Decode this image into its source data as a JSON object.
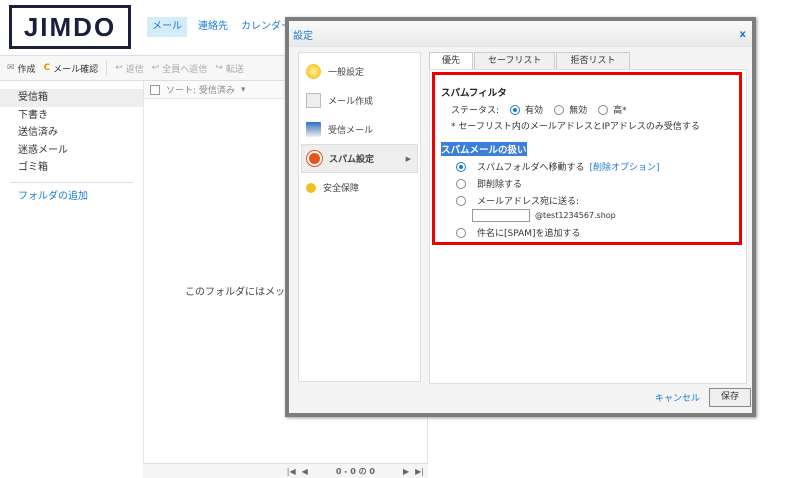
{
  "header": {
    "logo": "JIMDO",
    "nav": [
      "メール",
      "連絡先",
      "カレンダー"
    ]
  },
  "toolbar": {
    "compose": "作成",
    "check": "メール確認",
    "reply": "返信",
    "reply_all": "全員へ返信",
    "forward": "転送"
  },
  "sidebar": {
    "folders": [
      "受信箱",
      "下書き",
      "送信済み",
      "迷惑メール",
      "ゴミ箱"
    ],
    "add_folder": "フォルダの追加"
  },
  "list": {
    "sort": "ソート: 受信済み",
    "empty": "このフォルダにはメッセ",
    "pager": "0 - 0 の 0"
  },
  "dialog": {
    "title": "設定",
    "close": "x",
    "nav": [
      {
        "label": "一般設定",
        "icon": "gear-icon"
      },
      {
        "label": "メール作成",
        "icon": "compose-icon"
      },
      {
        "label": "受信メール",
        "icon": "inbox-icon"
      },
      {
        "label": "スパム設定",
        "icon": "no-entry-icon"
      },
      {
        "label": "安全保障",
        "icon": "key-icon"
      }
    ],
    "tabs": [
      "優先",
      "セーフリスト",
      "拒否リスト"
    ],
    "spam_filter": {
      "heading": "スパムフィルタ",
      "status_label": "ステータス:",
      "options": [
        "有効",
        "無効",
        "高*"
      ],
      "selected": "有効",
      "note": "* セーフリスト内のメールアドレスとIPアドレスのみ受信する"
    },
    "handling": {
      "heading": "スパムメールの扱い",
      "move": "スパムフォルダへ移動する",
      "delete_options": "[削除オプション]",
      "delete_now": "即削除する",
      "send_to": "メールアドレス宛に送る:",
      "address_value": "",
      "domain": "@test1234567.shop",
      "add_tag": "件名に[SPAM]を追加する",
      "selected": "move"
    },
    "cancel": "キャンセル",
    "save": "保存"
  },
  "colors": {
    "accent": "#1a7bd1",
    "highlight": "#e00000"
  }
}
